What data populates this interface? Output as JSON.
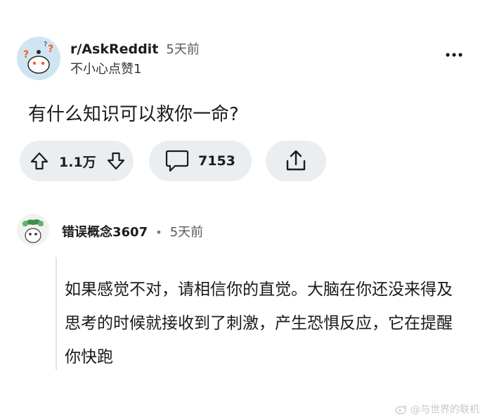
{
  "post": {
    "subreddit": "r/AskReddit",
    "time": "5天前",
    "author": "不小心点赞1",
    "title": "有什么知识可以救你一命?",
    "votes": "1.1万",
    "comments": "7153"
  },
  "comment": {
    "author": "错误概念3607",
    "separator": "•",
    "time": "5天前",
    "body": "如果感觉不对，请相信你的直觉。大脑在你还没来得及思考的时候就接收到了刺激，产生恐惧反应，它在提醒你快跑"
  },
  "watermark": {
    "text": "@与世界的联机"
  },
  "colors": {
    "pill_bg": "#eaeef1",
    "thread_line": "#e0e3e6",
    "avatar_bg": "#cfe6f2"
  },
  "icons": [
    "snoo-avatar-icon",
    "more-options-icon",
    "upvote-icon",
    "downvote-icon",
    "comment-icon",
    "share-icon",
    "comment-avatar-icon",
    "weibo-icon"
  ]
}
